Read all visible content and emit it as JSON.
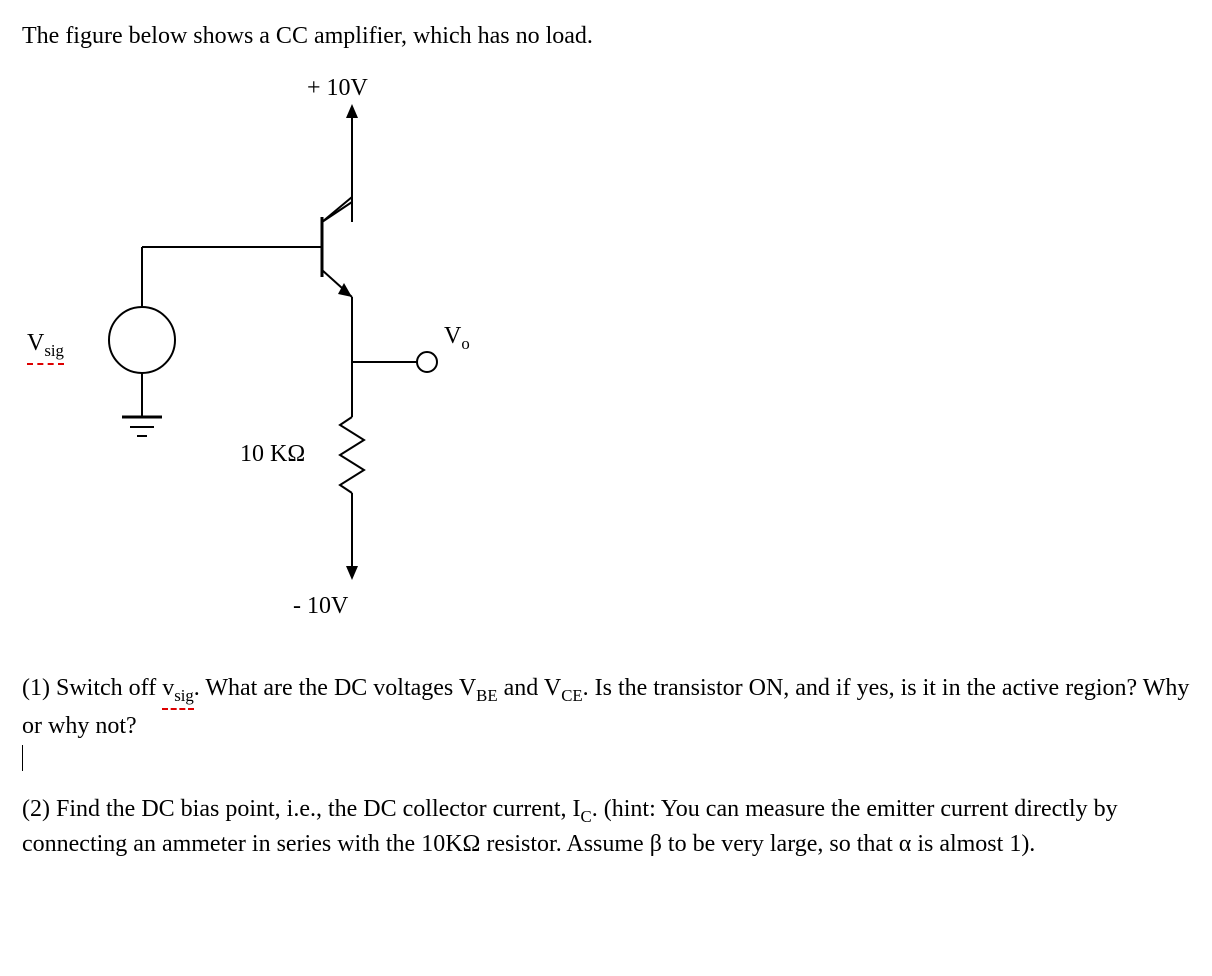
{
  "intro": "The figure below shows a CC amplifier, which has no load.",
  "circuit": {
    "top_supply": "+ 10V",
    "bottom_supply": "- 10V",
    "resistor": "10 KΩ",
    "vsig_prefix": "V",
    "vsig_sub": "sig",
    "vo_prefix": "V",
    "vo_sub": "o"
  },
  "q1": {
    "prefix": "(1) Switch off ",
    "vsig_v": "v",
    "vsig_sub": "sig",
    "mid": ". What are the DC voltages V",
    "vbe_sub": "BE",
    "and": " and V",
    "vce_sub": "CE",
    "rest": ". Is the transistor ON, and if yes, is it in the active region? Why or why not?"
  },
  "q2": {
    "prefix": "(2) Find the DC bias point, i.e., the DC collector current, I",
    "ic_sub": "C",
    "mid": ".  (hint: You can measure the emitter current directly by connecting an ammeter in series with the 10KΩ resistor. Assume β to be very large, so that α is almost 1)."
  }
}
